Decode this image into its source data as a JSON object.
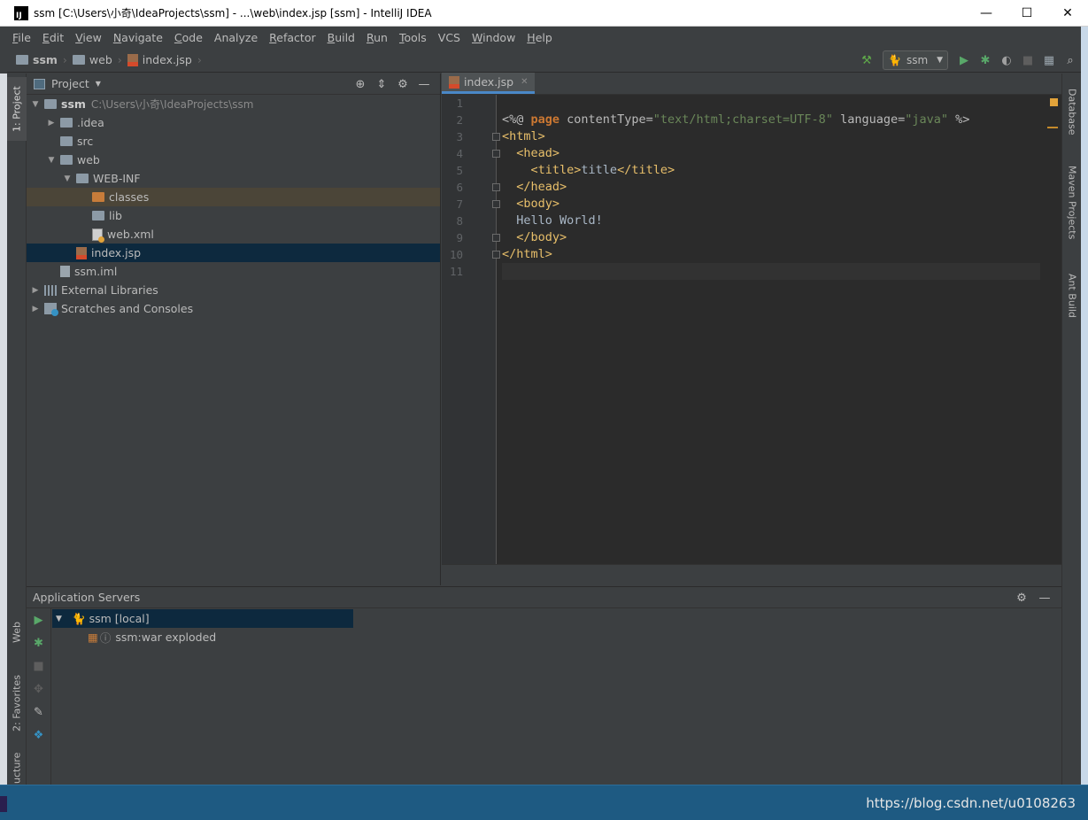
{
  "window": {
    "title": "ssm [C:\\Users\\小奇\\IdeaProjects\\ssm] - ...\\web\\index.jsp [ssm] - IntelliJ IDEA",
    "app_icon_label": "IJ",
    "minimize": "—",
    "maximize": "☐",
    "close": "✕"
  },
  "menu": [
    {
      "label": "File",
      "mnemonic": "F",
      "rest": "ile"
    },
    {
      "label": "Edit",
      "mnemonic": "E",
      "rest": "dit"
    },
    {
      "label": "View",
      "mnemonic": "V",
      "rest": "iew"
    },
    {
      "label": "Navigate",
      "mnemonic": "N",
      "rest": "avigate"
    },
    {
      "label": "Code",
      "mnemonic": "C",
      "rest": "ode"
    },
    {
      "label": "Analyze",
      "mnemonic": "",
      "rest": "Analyze"
    },
    {
      "label": "Refactor",
      "mnemonic": "R",
      "rest": "efactor"
    },
    {
      "label": "Build",
      "mnemonic": "B",
      "rest": "uild"
    },
    {
      "label": "Run",
      "mnemonic": "R",
      "rest": "un"
    },
    {
      "label": "Tools",
      "mnemonic": "T",
      "rest": "ools"
    },
    {
      "label": "VCS",
      "mnemonic": "",
      "rest": "VCS"
    },
    {
      "label": "Window",
      "mnemonic": "W",
      "rest": "indow"
    },
    {
      "label": "Help",
      "mnemonic": "H",
      "rest": "elp"
    }
  ],
  "breadcrumbs": [
    "ssm",
    "web",
    "index.jsp"
  ],
  "toolbar": {
    "run_config": "ssm",
    "build_icon": "hammer-icon",
    "run_icon": "run-icon",
    "debug_icon": "debug-icon",
    "coverage_icon": "coverage-icon",
    "stop_icon": "stop-icon",
    "project_structure_icon": "project-structure-icon",
    "search_icon": "search-icon"
  },
  "left_strip": {
    "project_tab": "1: Project",
    "web_tab": "Web",
    "favorites_tab": "2: Favorites",
    "structure_tab": "ucture"
  },
  "right_strip": {
    "database_tab": "Database",
    "maven_tab": "Maven Projects",
    "ant_tab": "Ant Build"
  },
  "project_panel": {
    "title": "Project",
    "tree": [
      {
        "label": "ssm",
        "path": "C:\\Users\\小奇\\IdeaProjects\\ssm",
        "indent": 0,
        "arrow": "▼",
        "icon": "module-folder"
      },
      {
        "label": ".idea",
        "indent": 1,
        "arrow": "▶",
        "icon": "folder"
      },
      {
        "label": "src",
        "indent": 1,
        "arrow": "",
        "icon": "folder"
      },
      {
        "label": "web",
        "indent": 1,
        "arrow": "▼",
        "icon": "folder"
      },
      {
        "label": "WEB-INF",
        "indent": 2,
        "arrow": "▼",
        "icon": "folder"
      },
      {
        "label": "classes",
        "indent": 3,
        "arrow": "",
        "icon": "excluded-folder"
      },
      {
        "label": "lib",
        "indent": 3,
        "arrow": "",
        "icon": "folder"
      },
      {
        "label": "web.xml",
        "indent": 3,
        "arrow": "",
        "icon": "xml"
      },
      {
        "label": "index.jsp",
        "indent": 2,
        "arrow": "",
        "icon": "jsp"
      },
      {
        "label": "ssm.iml",
        "indent": 1,
        "arrow": "",
        "icon": "iml"
      },
      {
        "label": "External Libraries",
        "indent": 0,
        "arrow": "▶",
        "icon": "libraries"
      },
      {
        "label": "Scratches and Consoles",
        "indent": 0,
        "arrow": "▶",
        "icon": "scratches"
      }
    ]
  },
  "editor": {
    "tab_label": "index.jsp",
    "line_numbers": [
      "1",
      "2",
      "3",
      "4",
      "5",
      "6",
      "7",
      "8",
      "9",
      "10",
      "11"
    ],
    "lines": [
      "",
      "<%@ page contentType=\"text/html;charset=UTF-8\" language=\"java\" %>",
      "<html>",
      "  <head>",
      "    <title>title</title>",
      "  </head>",
      "  <body>",
      "  Hello World!",
      "  </body>",
      "</html>",
      ""
    ]
  },
  "app_servers": {
    "title": "Application Servers",
    "server": "ssm [local]",
    "artifact": "ssm:war exploded"
  },
  "taskbar": {
    "watermark": "https://blog.csdn.net/u0108263"
  }
}
